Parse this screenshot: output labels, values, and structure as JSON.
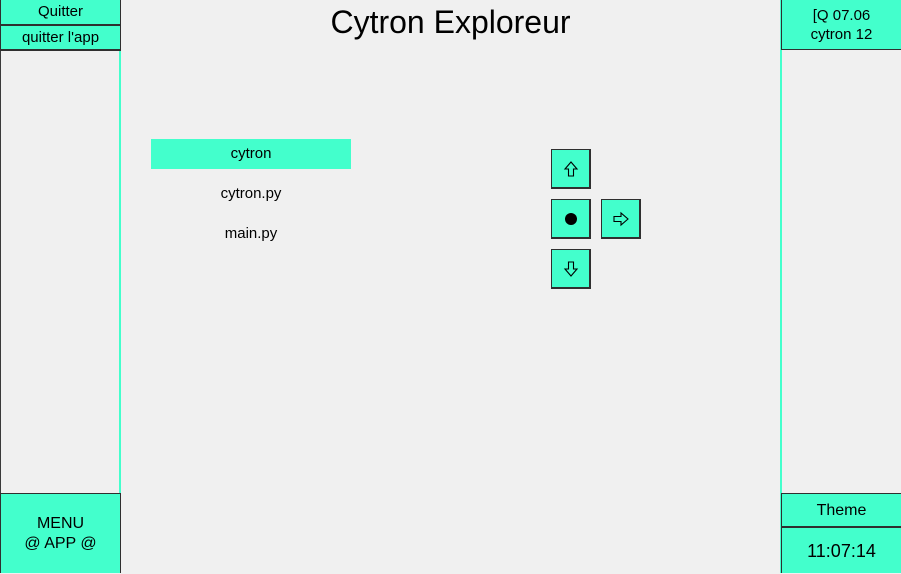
{
  "title": "Cytron Exploreur",
  "left_panel": {
    "quit_label": "Quitter",
    "quit_app_label": "quitter l'app",
    "menu_line1": "MENU",
    "menu_line2": "@ APP @"
  },
  "right_panel": {
    "info_line1": "[Q 07.06",
    "info_line2": "cytron 12",
    "theme_label": "Theme",
    "clock": "11:07:14"
  },
  "files": [
    {
      "name": "cytron",
      "selected": true
    },
    {
      "name": "cytron.py",
      "selected": false
    },
    {
      "name": "main.py",
      "selected": false
    }
  ],
  "navigation": {
    "up_icon": "arrow-up-icon",
    "select_icon": "dot-icon",
    "right_icon": "arrow-right-icon",
    "down_icon": "arrow-down-icon"
  },
  "colors": {
    "accent": "#43ffcc",
    "background": "#f0f0f0",
    "border": "#2f2f2f"
  }
}
